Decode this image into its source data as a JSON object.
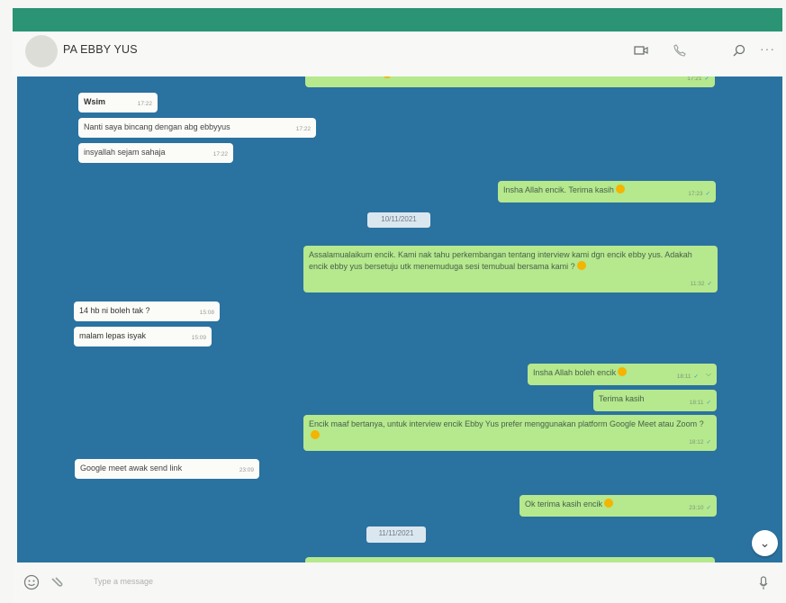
{
  "header": {
    "contact_name": "PA EBBY YUS",
    "icons": [
      "video-call-icon",
      "phone-icon",
      "search-icon",
      "more-icon"
    ]
  },
  "messages": [
    {
      "dir": "out",
      "text": "",
      "time": "17:21",
      "emoji": true
    },
    {
      "dir": "in",
      "text": "Wsim",
      "time": "17:22"
    },
    {
      "dir": "in",
      "text": "Nanti saya bincang dengan abg ebbyyus",
      "time": "17:22"
    },
    {
      "dir": "in",
      "text": "insyallah sejam sahaja",
      "time": "17:22"
    },
    {
      "dir": "out",
      "text": "Insha Allah encik. Terima kasih",
      "time": "17:23",
      "emoji": true
    },
    {
      "dir": "date",
      "text": "10/11/2021"
    },
    {
      "dir": "out",
      "text": "Assalamualaikum encik. Kami nak tahu perkembangan tentang interview kami dgn encik ebby yus. Adakah encik ebby yus bersetuju utk menemuduga sesi temubual bersama kami ?",
      "time": "11:32",
      "emoji": true
    },
    {
      "dir": "in",
      "text": "14 hb ni boleh tak ?",
      "time": "15:08"
    },
    {
      "dir": "in",
      "text": "malam lepas isyak",
      "time": "15:09"
    },
    {
      "dir": "out",
      "text": "Insha Allah boleh encik",
      "time": "18:11",
      "emoji": true
    },
    {
      "dir": "out",
      "text": "Terima kasih",
      "time": "18:11"
    },
    {
      "dir": "out",
      "text": "Encik maaf bertanya, untuk interview encik Ebby Yus prefer menggunakan platform Google Meet atau Zoom ?",
      "time": "18:12",
      "emoji": true
    },
    {
      "dir": "in",
      "text": "Google meet awak send link",
      "time": "23:09"
    },
    {
      "dir": "out",
      "text": "Ok terima kasih encik",
      "time": "23:10",
      "emoji": true
    },
    {
      "dir": "date",
      "text": "11/11/2021"
    }
  ],
  "footer": {
    "placeholder": "Type a message",
    "icons": [
      "emoji-icon",
      "attach-icon",
      "mic-icon"
    ]
  },
  "colors": {
    "topbar": "#2a9474",
    "chat_bg": "#2a72a0",
    "incoming": "#fbfbf8",
    "outgoing": "#b6e88d",
    "tick": "#3d9bd8"
  }
}
